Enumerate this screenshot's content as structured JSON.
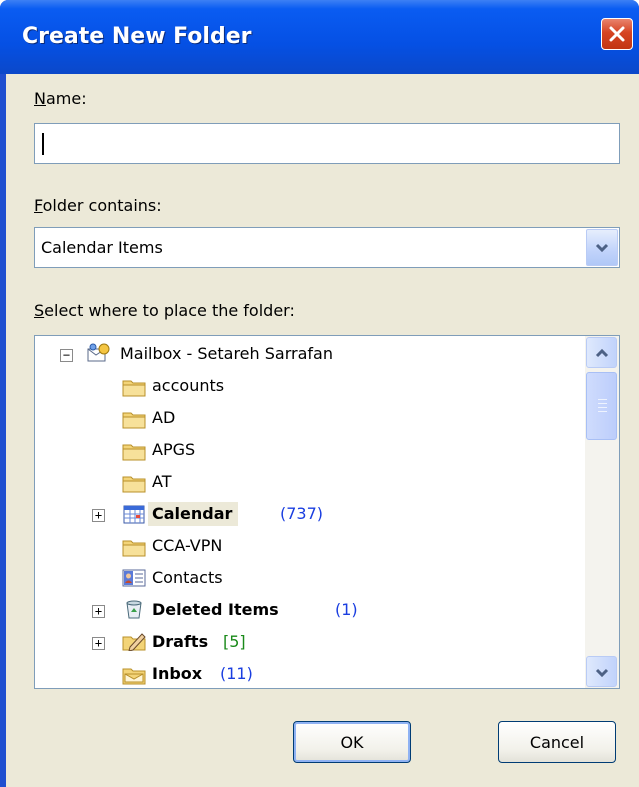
{
  "window": {
    "title": "Create New Folder"
  },
  "name_field": {
    "label_accel": "N",
    "label_rest": "ame:",
    "value": ""
  },
  "contains_field": {
    "label_accel": "F",
    "label_rest": "older contains:",
    "value": "Calendar Items"
  },
  "place_label": {
    "accel": "S",
    "rest": "elect where to place the folder:"
  },
  "tree": {
    "root": {
      "label": "Mailbox - Setareh Sarrafan",
      "expander": "−",
      "icon": "mailbox-icon"
    },
    "items": [
      {
        "label": "accounts",
        "icon": "folder-icon"
      },
      {
        "label": "AD",
        "icon": "folder-icon"
      },
      {
        "label": "APGS",
        "icon": "folder-icon"
      },
      {
        "label": "AT",
        "icon": "folder-icon"
      },
      {
        "label": "Calendar",
        "count": "(737)",
        "icon": "calendar-icon",
        "expander": "+",
        "bold": true,
        "selected": true
      },
      {
        "label": "CCA-VPN",
        "icon": "folder-icon"
      },
      {
        "label": "Contacts",
        "icon": "contacts-icon"
      },
      {
        "label": "Deleted Items",
        "count": "(1)",
        "icon": "deleted-items-icon",
        "expander": "+",
        "bold": true
      },
      {
        "label": "Drafts",
        "count": "[5]",
        "icon": "drafts-icon",
        "expander": "+",
        "bold": true
      },
      {
        "label": "Inbox",
        "count": "(11)",
        "icon": "inbox-icon",
        "bold": true
      }
    ]
  },
  "buttons": {
    "ok": "OK",
    "cancel": "Cancel"
  },
  "colors": {
    "titlebar": "#0550e4",
    "client": "#ece9d8",
    "count_blue": "#1a3ee0",
    "count_green": "#1a8a1a"
  }
}
